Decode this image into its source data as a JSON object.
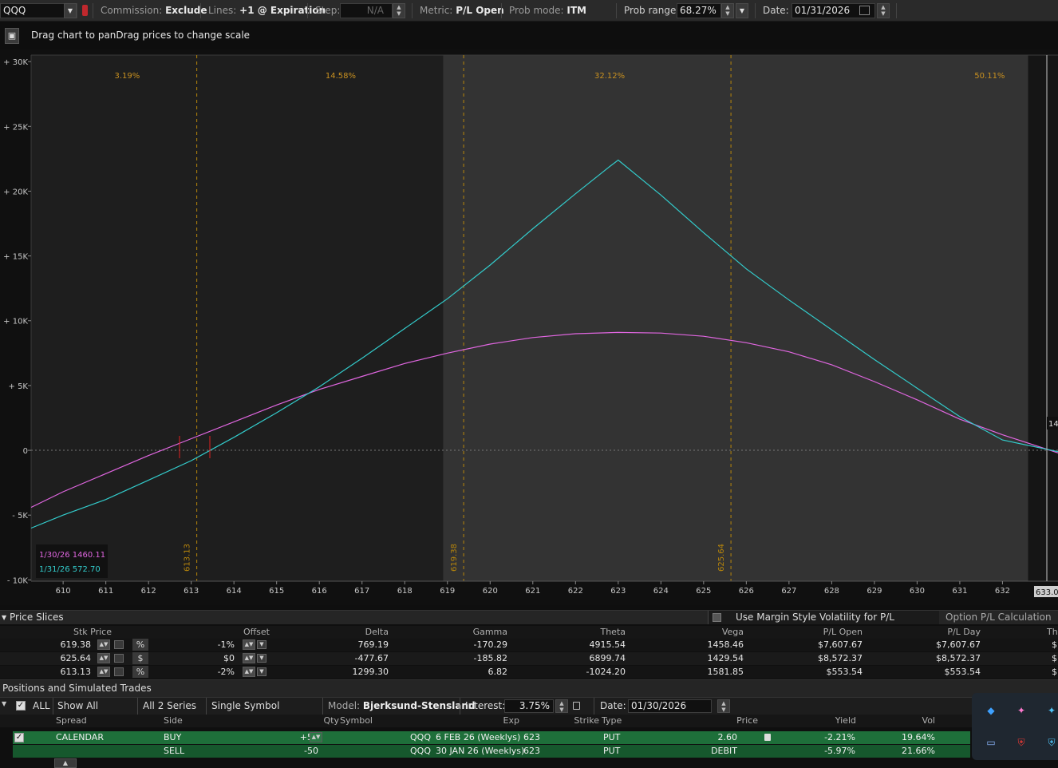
{
  "toolbar": {
    "symbol": "QQQ",
    "commission_label": "Commission:",
    "commission_value": "Exclude",
    "lines_label": "Lines:",
    "lines_value": "+1 @ Expiration",
    "step_label": "Step:",
    "step_value": "N/A",
    "metric_label": "Metric:",
    "metric_value": "P/L Open",
    "prob_mode_label": "Prob mode:",
    "prob_mode_value": "ITM",
    "prob_range_label": "Prob range:",
    "prob_range_value": "68.27%",
    "date_label": "Date:",
    "date_value": "01/31/2026"
  },
  "chart_header": {
    "message": "Drag chart to panDrag prices to change scale"
  },
  "chart_data": {
    "type": "line",
    "xlim": [
      609.25,
      633.3
    ],
    "ylim": [
      -10100,
      30500
    ],
    "x_ticks": [
      "610",
      "611",
      "612",
      "613",
      "614",
      "615",
      "616",
      "617",
      "618",
      "619",
      "620",
      "621",
      "622",
      "623",
      "624",
      "625",
      "626",
      "627",
      "628",
      "629",
      "630",
      "631",
      "632"
    ],
    "y_ticks": [
      {
        "v": 30000,
        "label": "+ 30K"
      },
      {
        "v": 25000,
        "label": "+ 25K"
      },
      {
        "v": 20000,
        "label": "+ 20K"
      },
      {
        "v": 15000,
        "label": "+ 15K"
      },
      {
        "v": 10000,
        "label": "+ 10K"
      },
      {
        "v": 5000,
        "label": "+ 5K"
      },
      {
        "v": 0,
        "label": "0"
      },
      {
        "v": -5000,
        "label": "- 5K"
      },
      {
        "v": -10000,
        "label": "- 10K"
      }
    ],
    "zones": [
      {
        "x0": 609.25,
        "x1": 618.9,
        "color": "#1e1e1e",
        "prob": "3.19%",
        "prob_x": 611.5
      },
      {
        "x0": 609.25,
        "x1": 618.9,
        "color": "#1e1e1e",
        "prob": "14.58%",
        "prob_x": 616.5
      },
      {
        "x0": 618.9,
        "x1": 632.6,
        "color": "#333333",
        "prob": "32.12%",
        "prob_x": 622.8
      },
      {
        "x0": 632.6,
        "x1": 633.3,
        "color": "#151515",
        "prob": "50.11%",
        "prob_x": 631.7
      }
    ],
    "slice_lines": [
      {
        "x": 613.13,
        "label": "613.13"
      },
      {
        "x": 619.38,
        "label": "619.38"
      },
      {
        "x": 625.64,
        "label": "625.64"
      }
    ],
    "series": [
      {
        "name": "1/30/26",
        "readout": "1460.11",
        "color": "#e066e0",
        "x": [
          609.25,
          610,
          611,
          612,
          613,
          614,
          615,
          616,
          617,
          618,
          619,
          620,
          621,
          622,
          623,
          624,
          625,
          626,
          627,
          628,
          629,
          630,
          631,
          632,
          633.3
        ],
        "y": [
          -4400,
          -3200,
          -1800,
          -400,
          900,
          2200,
          3500,
          4700,
          5700,
          6700,
          7500,
          8200,
          8700,
          9000,
          9100,
          9050,
          8800,
          8300,
          7600,
          6600,
          5300,
          3900,
          2400,
          1200,
          -200
        ]
      },
      {
        "name": "1/31/26",
        "readout": "572.70",
        "color": "#33cccc",
        "x": [
          609.25,
          610,
          611,
          612,
          613,
          614,
          615,
          616,
          617,
          618,
          619,
          620,
          621,
          622,
          622.8,
          623,
          624,
          625,
          626,
          627,
          628,
          629,
          630,
          631,
          632,
          633.3
        ],
        "y": [
          -6000,
          -5000,
          -3800,
          -2300,
          -800,
          1000,
          2900,
          4900,
          7100,
          9400,
          11700,
          14300,
          17100,
          19800,
          21900,
          22400,
          19700,
          16800,
          14000,
          11600,
          9300,
          7000,
          4800,
          2600,
          800,
          -100
        ]
      }
    ],
    "right_tag": "14",
    "cursor_price": "633.0"
  },
  "price_slices": {
    "title": "Price Slices",
    "margin_label": "Use Margin Style Volatility for P/L Calculations",
    "option_calc_label": "Option P/L Calculation (Live",
    "headers": [
      "Stk Price",
      "Offset",
      "Delta",
      "Gamma",
      "Theta",
      "Vega",
      "P/L Open",
      "P/L Day",
      "Th"
    ],
    "rows": [
      {
        "stk": "619.38",
        "mode": "%",
        "offset": "-1%",
        "delta": "769.19",
        "gamma": "-170.29",
        "theta": "4915.54",
        "vega": "1458.46",
        "pl_open": "$7,607.67",
        "pl_day": "$7,607.67",
        "th": "$"
      },
      {
        "stk": "625.64",
        "mode": "$",
        "offset": "$0",
        "delta": "-477.67",
        "gamma": "-185.82",
        "theta": "6899.74",
        "vega": "1429.54",
        "pl_open": "$8,572.37",
        "pl_day": "$8,572.37",
        "th": "$"
      },
      {
        "stk": "613.13",
        "mode": "%",
        "offset": "-2%",
        "delta": "1299.30",
        "gamma": "6.82",
        "theta": "-1024.20",
        "vega": "1581.85",
        "pl_open": "$553.54",
        "pl_day": "$553.54",
        "th": "$"
      }
    ]
  },
  "positions": {
    "title": "Positions and Simulated Trades",
    "all_label": "ALL",
    "show_all": "Show All",
    "all_series": "All 2 Series",
    "single_symbol": "Single Symbol",
    "model_label": "Model:",
    "model_value": "Bjerksund-Stensland",
    "interest_label": "Interest:",
    "interest_value": "3.75%",
    "date_label": "Date:",
    "date_value": "01/30/2026",
    "headers": [
      "Spread",
      "Side",
      "Qty",
      "Symbol",
      "Exp",
      "Strike",
      "Type",
      "Price",
      "Yield",
      "Vol"
    ],
    "rows": [
      {
        "spread": "CALENDAR",
        "side": "BUY",
        "qty": "+50",
        "symbol": "QQQ",
        "exp": "6 FEB 26 (Weeklys)",
        "strike": "623",
        "type": "PUT",
        "price": "2.60",
        "yield": "-2.21%",
        "vol": "19.64%"
      },
      {
        "spread": "",
        "side": "SELL",
        "qty": "-50",
        "symbol": "QQQ",
        "exp": "30 JAN 26 (Weeklys)",
        "strike": "623",
        "type": "PUT",
        "price": "DEBIT",
        "yield": "-5.97%",
        "vol": "21.66%"
      }
    ]
  },
  "colors": {
    "accent_green": "#1e6f3a",
    "series_pink": "#e066e0",
    "series_cyan": "#33cccc",
    "zone_label": "#c89020"
  }
}
